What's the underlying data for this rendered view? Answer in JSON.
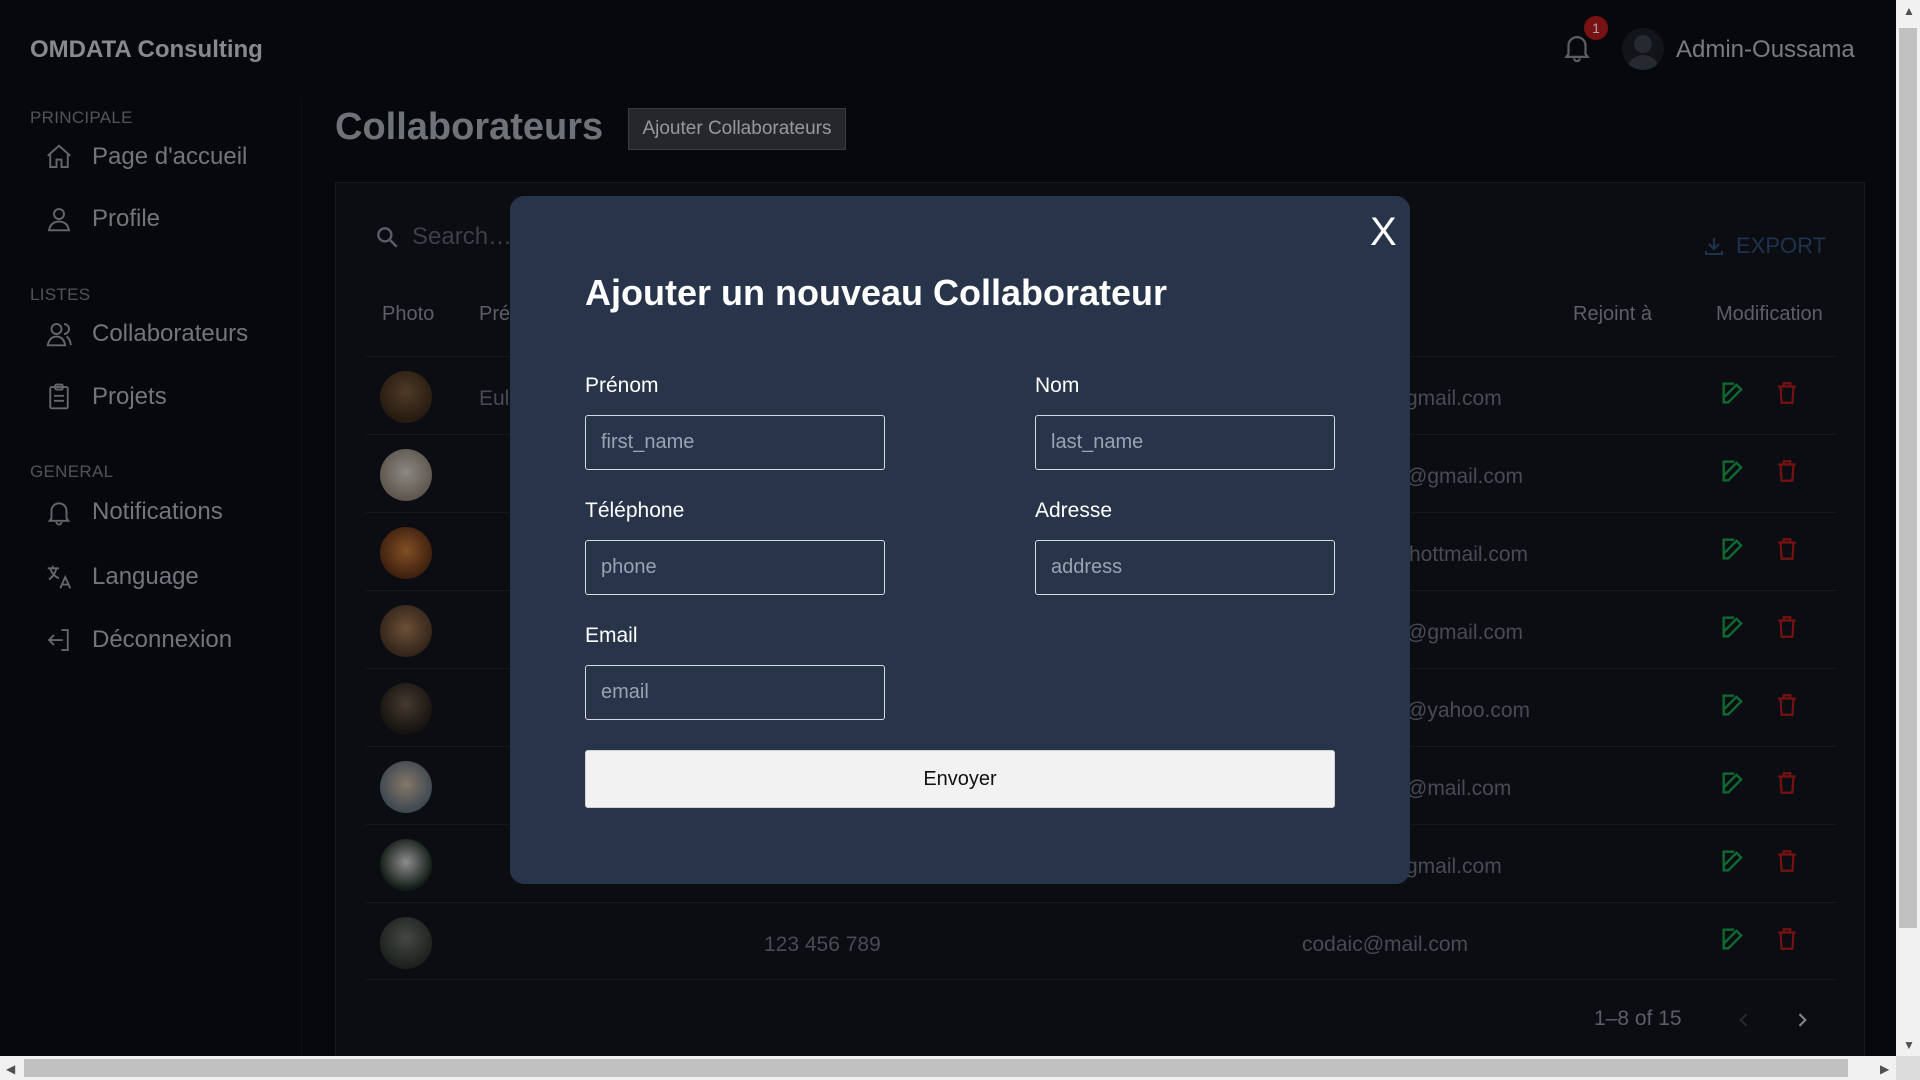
{
  "header": {
    "brand": "OMDATA Consulting",
    "notification_count": "1",
    "user_name": "Admin-Oussama"
  },
  "sidebar": {
    "sections": [
      {
        "label": "PRINCIPALE"
      },
      {
        "label": "LISTES"
      },
      {
        "label": "GENERAL"
      }
    ],
    "items": [
      {
        "label": "Page d'accueil",
        "icon": "home-icon"
      },
      {
        "label": "Profile",
        "icon": "user-icon"
      },
      {
        "label": "Collaborateurs",
        "icon": "users-icon"
      },
      {
        "label": "Projets",
        "icon": "clipboard-icon"
      },
      {
        "label": "Notifications",
        "icon": "bell-icon"
      },
      {
        "label": "Language",
        "icon": "translate-icon"
      },
      {
        "label": "Déconnexion",
        "icon": "logout-icon"
      }
    ]
  },
  "main": {
    "title": "Collaborateurs",
    "add_button": "Ajouter Collaborateurs",
    "search_placeholder": "Search…",
    "export_label": "EXPORT",
    "columns": {
      "photo": "Photo",
      "prenom_partial": "Pré",
      "joined": "Rejoint à",
      "modification": "Modification"
    },
    "rows": [
      {
        "name_partial": "Eul",
        "phone": "",
        "email_partial": "gmail.com"
      },
      {
        "name_partial": "",
        "phone": "",
        "email_partial": "@gmail.com"
      },
      {
        "name_partial": "",
        "phone": "",
        "email_partial": "hottmail.com"
      },
      {
        "name_partial": "",
        "phone": "",
        "email_partial": "@gmail.com"
      },
      {
        "name_partial": "",
        "phone": "",
        "email_partial": "@yahoo.com"
      },
      {
        "name_partial": "",
        "phone": "",
        "email_partial": "@mail.com"
      },
      {
        "name_partial": "",
        "phone": "",
        "email_partial": "gmail.com"
      },
      {
        "name_partial": "",
        "phone": "123 456 789",
        "email_partial": "codaic@mail.com"
      }
    ],
    "pagination": "1–8 of 15"
  },
  "modal": {
    "title": "Ajouter un nouveau Collaborateur",
    "close_label": "X",
    "fields": {
      "first_name": {
        "label": "Prénom",
        "placeholder": "first_name"
      },
      "last_name": {
        "label": "Nom",
        "placeholder": "last_name"
      },
      "phone": {
        "label": "Téléphone",
        "placeholder": "phone"
      },
      "address": {
        "label": "Adresse",
        "placeholder": "address"
      },
      "email": {
        "label": "Email",
        "placeholder": "email"
      }
    },
    "submit_label": "Envoyer"
  },
  "colors": {
    "background": "#0b0d13",
    "modal_bg": "#28344a",
    "edit_green": "#16a34a",
    "delete_red": "#b91c1c",
    "badge_red": "#b91c1c"
  }
}
